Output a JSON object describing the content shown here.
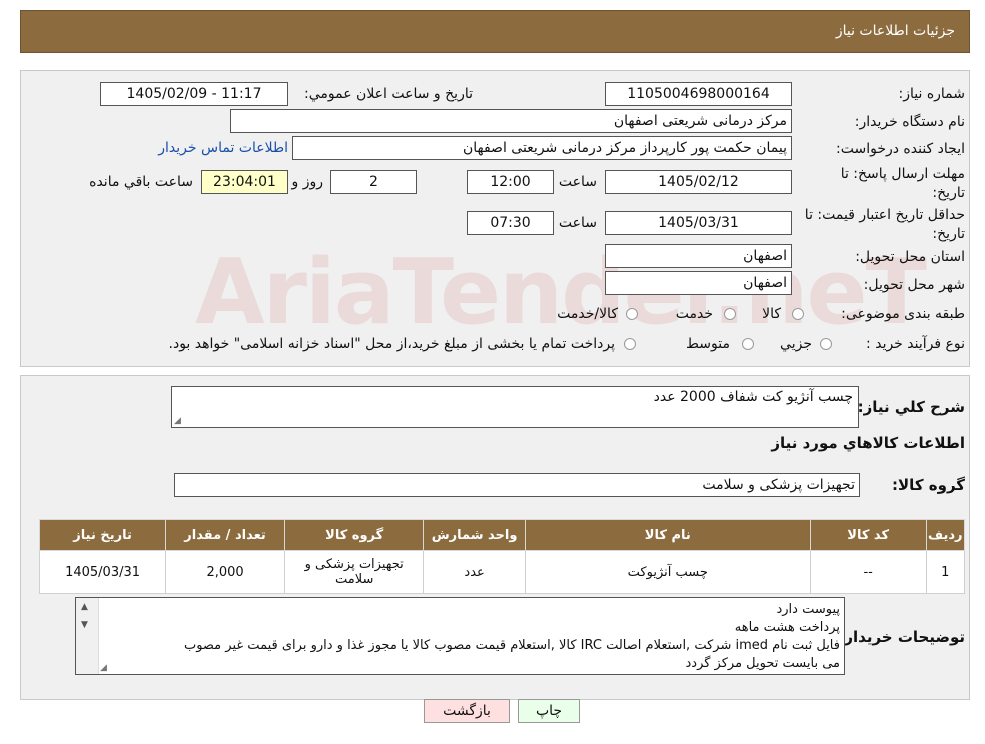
{
  "header": {
    "title": "جزئیات اطلاعات نیاز"
  },
  "watermark": "AriaTender.neT",
  "form": {
    "need_number": {
      "label": "شماره نیاز:",
      "value": "1105004698000164"
    },
    "announce": {
      "label": "تاریخ و ساعت اعلان عمومي:",
      "value": "1405/02/09 - 11:17"
    },
    "buyer_org": {
      "label": "نام دستگاه خریدار:",
      "value": "مرکز درمانی شریعتی اصفهان"
    },
    "requester": {
      "label": "ایجاد کننده درخواست:",
      "value": "پیمان حکمت پور کارپرداز مرکز درمانی شریعتی اصفهان",
      "contact_link": "اطلاعات تماس خریدار"
    },
    "reply_deadline": {
      "label": "مهلت ارسال پاسخ: تا تاریخ:",
      "date": "1405/02/12",
      "time_label": "ساعت",
      "time": "12:00",
      "days": "2",
      "days_label": "روز و",
      "remaining": "23:04:01",
      "remaining_label": "ساعت باقي مانده"
    },
    "price_validity": {
      "label": "حداقل تاریخ اعتبار قیمت: تا تاریخ:",
      "date": "1405/03/31",
      "time_label": "ساعت",
      "time": "07:30"
    },
    "province": {
      "label": "استان محل تحویل:",
      "value": "اصفهان"
    },
    "city": {
      "label": "شهر محل تحویل:",
      "value": "اصفهان"
    },
    "category": {
      "label": "طبقه بندی موضوعی:",
      "options": [
        "کالا",
        "خدمت",
        "کالا/خدمت"
      ]
    },
    "process": {
      "label": "نوع فرآیند خرید :",
      "options": [
        "جزيي",
        "متوسط"
      ],
      "note": "پرداخت تمام یا بخشی از مبلغ خرید،از محل \"اسناد خزانه اسلامی\" خواهد بود."
    }
  },
  "summary": {
    "label": "شرح کلي نیاز:",
    "value": "چسب آنژیو کت شفاف 2000 عدد",
    "items_title": "اطلاعات کالاهاي مورد نیاز",
    "group_label": "گروه کالا:",
    "group_value": "تجهیزات پزشکی و سلامت"
  },
  "table": {
    "headers": [
      "ردیف",
      "کد کالا",
      "نام کالا",
      "واحد شمارش",
      "گروه کالا",
      "تعداد / مقدار",
      "تاریخ نیاز"
    ],
    "rows": [
      [
        "1",
        "--",
        "چسب آنژیوکت",
        "عدد",
        "تجهیزات پزشکی و سلامت",
        "2,000",
        "1405/03/31"
      ]
    ]
  },
  "buyer_notes": {
    "label": "توضیحات خریدار:",
    "lines": [
      "پیوست دارد",
      "پرداخت هشت ماهه",
      "فایل ثبت نام imed شرکت ,استعلام اصالت IRC کالا ,استعلام قیمت مصوب کالا یا مجوز غذا و دارو برای قیمت غیر مصوب",
      "می بایست تحویل مرکز گردد"
    ]
  },
  "buttons": {
    "print": "چاپ",
    "back": "بازگشت"
  }
}
